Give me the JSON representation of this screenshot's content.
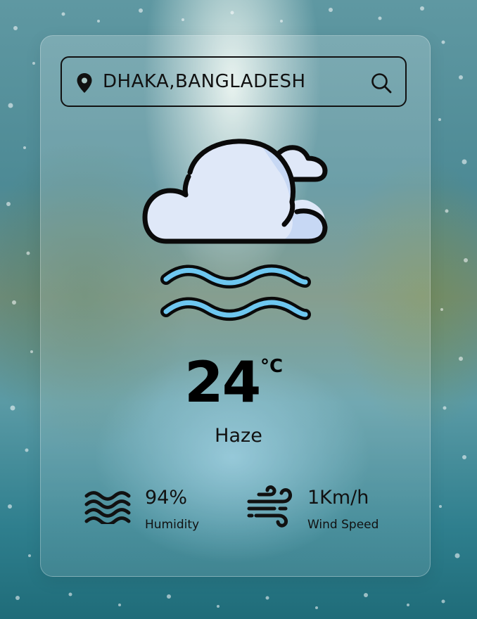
{
  "search": {
    "location_icon": "map-pin-icon",
    "city": "DHAKA,BANGLADESH",
    "search_icon": "search-icon"
  },
  "weather": {
    "icon": "cloud-haze-icon",
    "temperature": "24",
    "unit": "°C",
    "condition": "Haze"
  },
  "details": {
    "humidity": {
      "icon": "waves-icon",
      "value": "94%",
      "label": "Humidity"
    },
    "wind": {
      "icon": "wind-icon",
      "value": "1Km/h",
      "label": "Wind Speed"
    }
  },
  "colors": {
    "cloud_fill": "#dfe8f8",
    "cloud_shade": "#c7d8f4",
    "haze_stripe": "#6ec7f0",
    "outline": "#0a0a0a"
  }
}
